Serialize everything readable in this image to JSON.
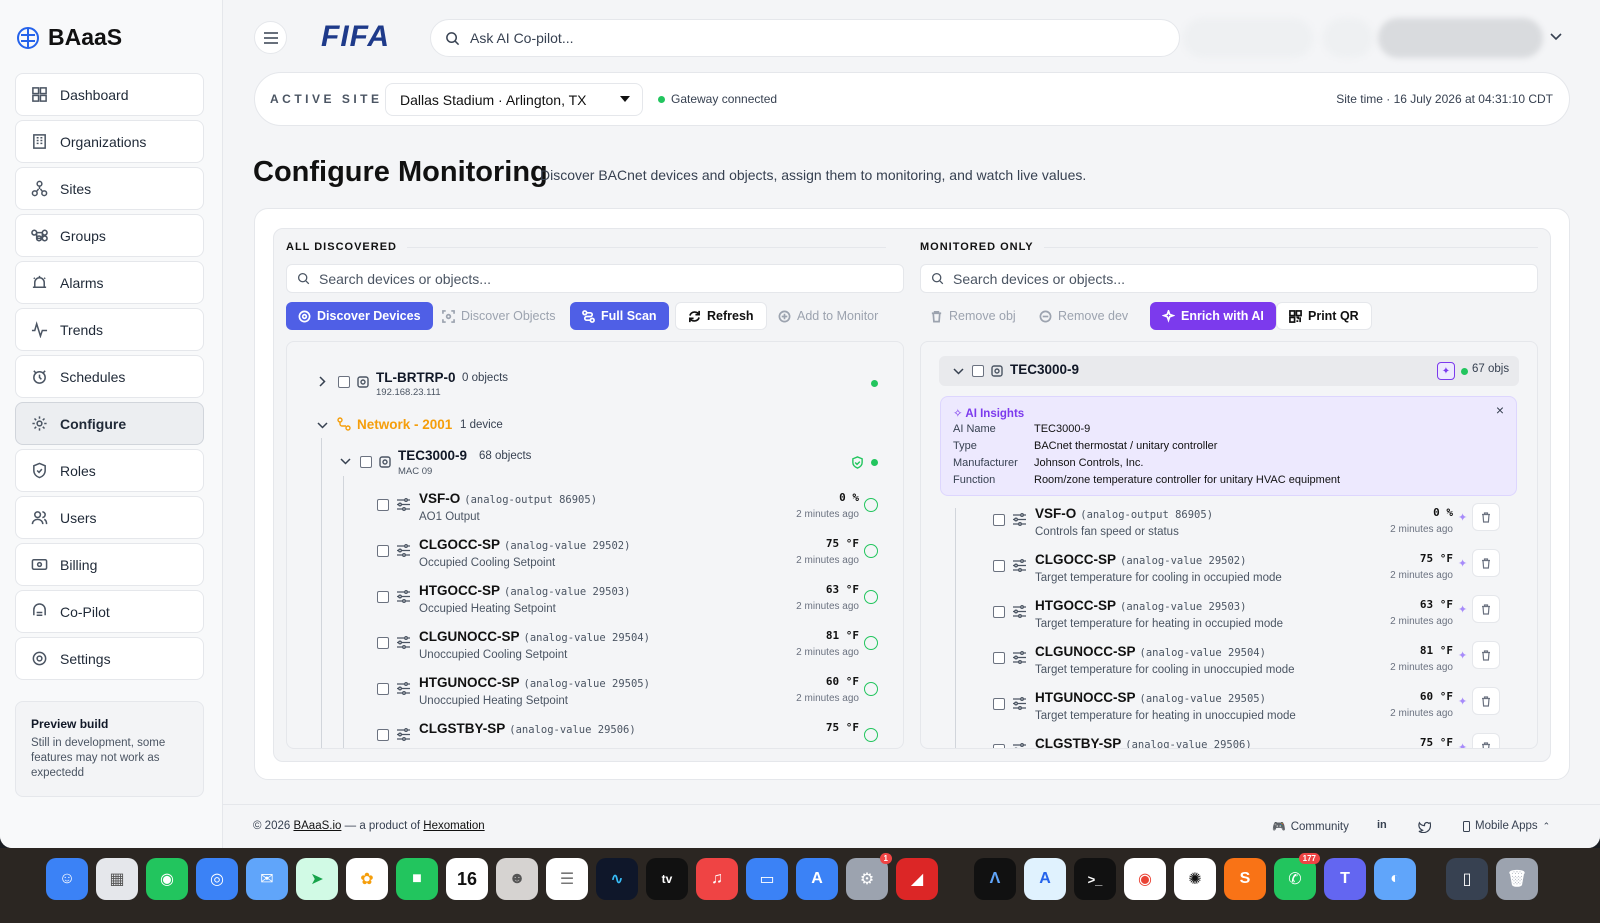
{
  "app": {
    "brand": "BAaaS",
    "logo_text": "FIFA"
  },
  "sidebar": {
    "items": [
      {
        "label": "Dashboard",
        "icon": "dashboard-icon"
      },
      {
        "label": "Organizations",
        "icon": "building-icon"
      },
      {
        "label": "Sites",
        "icon": "sites-icon"
      },
      {
        "label": "Groups",
        "icon": "command-icon"
      },
      {
        "label": "Alarms",
        "icon": "alarm-icon"
      },
      {
        "label": "Trends",
        "icon": "trend-icon"
      },
      {
        "label": "Schedules",
        "icon": "clock-icon"
      },
      {
        "label": "Configure",
        "icon": "gear-icon",
        "active": true
      },
      {
        "label": "Roles",
        "icon": "shield-icon"
      },
      {
        "label": "Users",
        "icon": "users-icon"
      },
      {
        "label": "Billing",
        "icon": "billing-icon"
      },
      {
        "label": "Co-Pilot",
        "icon": "copilot-icon"
      },
      {
        "label": "Settings",
        "icon": "settings-icon"
      }
    ],
    "preview": {
      "title": "Preview build",
      "text": "Still in development, some features may not work as expectedd"
    }
  },
  "header": {
    "search_placeholder": "Ask AI Co-pilot..."
  },
  "site": {
    "label": "ACTIVE SITE",
    "selected": "Dallas Stadium · Arlington, TX",
    "gateway": "Gateway connected",
    "site_time": "Site time · 16 July 2026 at 04:31:10 CDT"
  },
  "page": {
    "title": "Configure Monitoring",
    "subtitle": "Discover BACnet devices and objects, assign them to monitoring, and watch live values."
  },
  "left": {
    "header": "ALL DISCOVERED",
    "search_placeholder": "Search devices or objects...",
    "buttons": {
      "discover_devices": "Discover Devices",
      "discover_objects": "Discover Objects",
      "full_scan": "Full Scan",
      "refresh": "Refresh",
      "add_to_monitor": "Add to Monitor"
    },
    "device1": {
      "name": "TL-BRTRP-0",
      "count": "0 objects",
      "ip": "192.168.23.111"
    },
    "network": {
      "name": "Network - 2001",
      "count": "1 device"
    },
    "device2": {
      "name": "TEC3000-9",
      "count": "68 objects",
      "mac": "MAC 09"
    },
    "objects": [
      {
        "name": "VSF-O",
        "kind": "(analog-output 86905)",
        "desc": "AO1 Output",
        "value": "0 %",
        "time": "2 minutes ago"
      },
      {
        "name": "CLGOCC-SP",
        "kind": "(analog-value 29502)",
        "desc": "Occupied Cooling Setpoint",
        "value": "75 °F",
        "time": "2 minutes ago"
      },
      {
        "name": "HTGOCC-SP",
        "kind": "(analog-value 29503)",
        "desc": "Occupied Heating Setpoint",
        "value": "63 °F",
        "time": "2 minutes ago"
      },
      {
        "name": "CLGUNOCC-SP",
        "kind": "(analog-value 29504)",
        "desc": "Unoccupied Cooling Setpoint",
        "value": "81 °F",
        "time": "2 minutes ago"
      },
      {
        "name": "HTGUNOCC-SP",
        "kind": "(analog-value 29505)",
        "desc": "Unoccupied Heating Setpoint",
        "value": "60 °F",
        "time": "2 minutes ago"
      },
      {
        "name": "CLGSTBY-SP",
        "kind": "(analog-value 29506)",
        "desc": "",
        "value": "75 °F",
        "time": ""
      }
    ]
  },
  "right": {
    "header": "MONITORED ONLY",
    "search_placeholder": "Search devices or objects...",
    "buttons": {
      "remove_obj": "Remove obj",
      "remove_dev": "Remove dev",
      "enrich": "Enrich with AI",
      "print_qr": "Print QR"
    },
    "device": {
      "name": "TEC3000-9",
      "count": "67 objs"
    },
    "insights": {
      "title": "AI Insights",
      "rows": [
        {
          "k": "AI Name",
          "v": "TEC3000-9"
        },
        {
          "k": "Type",
          "v": "BACnet thermostat / unitary controller"
        },
        {
          "k": "Manufacturer",
          "v": "Johnson Controls, Inc."
        },
        {
          "k": "Function",
          "v": "Room/zone temperature controller for unitary HVAC equipment"
        }
      ]
    },
    "objects": [
      {
        "name": "VSF-O",
        "kind": "(analog-output 86905)",
        "desc": "Controls fan speed or status",
        "value": "0 %",
        "time": "2 minutes ago"
      },
      {
        "name": "CLGOCC-SP",
        "kind": "(analog-value 29502)",
        "desc": "Target temperature for cooling in occupied mode",
        "value": "75 °F",
        "time": "2 minutes ago"
      },
      {
        "name": "HTGOCC-SP",
        "kind": "(analog-value 29503)",
        "desc": "Target temperature for heating in occupied mode",
        "value": "63 °F",
        "time": "2 minutes ago"
      },
      {
        "name": "CLGUNOCC-SP",
        "kind": "(analog-value 29504)",
        "desc": "Target temperature for cooling in unoccupied mode",
        "value": "81 °F",
        "time": "2 minutes ago"
      },
      {
        "name": "HTGUNOCC-SP",
        "kind": "(analog-value 29505)",
        "desc": "Target temperature for heating in unoccupied mode",
        "value": "60 °F",
        "time": "2 minutes ago"
      },
      {
        "name": "CLGSTBY-SP",
        "kind": "(analog-value 29506)",
        "desc": "",
        "value": "75 °F",
        "time": ""
      }
    ]
  },
  "footer": {
    "copyright": "© 2026",
    "site_link": "BAaaS.io",
    "middle": "— a product of",
    "company_link": "Hexomation",
    "community": "Community",
    "mobile": "Mobile Apps"
  },
  "dock": {
    "calendar_day": "16",
    "badges": {
      "settings": "1",
      "whatsapp": "177"
    }
  }
}
